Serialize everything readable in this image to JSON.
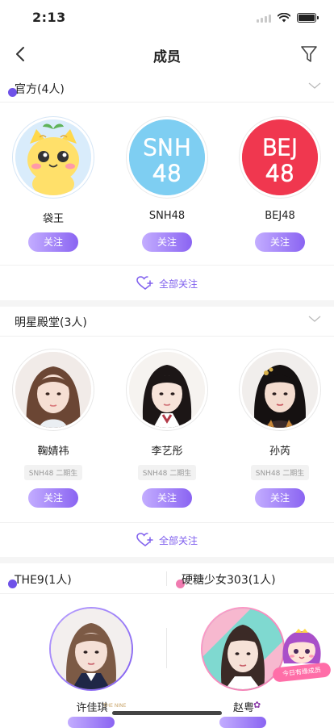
{
  "status_bar": {
    "time": "2:13"
  },
  "nav": {
    "title": "成员"
  },
  "colors": {
    "accent": "#8a64f2",
    "dot_purple": "#6f52e8",
    "dot_pink": "#f07bb0",
    "snh_blue": "#7ecef2",
    "bej_red": "#f0374f"
  },
  "sections": [
    {
      "title": "官方(4人)",
      "members": [
        {
          "name": "袋王",
          "follow": "关注",
          "avatar": "cartoon-cat-avatar"
        },
        {
          "name": "SNH48",
          "follow": "关注",
          "avatar": "snh48-logo",
          "logo_line1": "SNH",
          "logo_line2": "48"
        },
        {
          "name": "BEJ48",
          "follow": "关注",
          "avatar": "bej48-logo",
          "logo_line1": "BEJ",
          "logo_line2": "48"
        }
      ],
      "follow_all": "全部关注"
    },
    {
      "title": "明星殿堂(3人)",
      "members": [
        {
          "name": "鞠婧祎",
          "tag": "SNH48 二期生",
          "follow": "关注"
        },
        {
          "name": "李艺彤",
          "tag": "SNH48 二期生",
          "follow": "关注"
        },
        {
          "name": "孙芮",
          "tag": "SNH48 二期生",
          "follow": "关注"
        }
      ],
      "follow_all": "全部关注"
    }
  ],
  "groups": [
    {
      "title": "THE9(1人)",
      "member": {
        "name": "许佳琪",
        "badge": "THE NINE"
      }
    },
    {
      "title": "硬糖少女303(1人)",
      "member": {
        "name": "赵粤",
        "sticker": "今日有缘成员"
      }
    }
  ]
}
